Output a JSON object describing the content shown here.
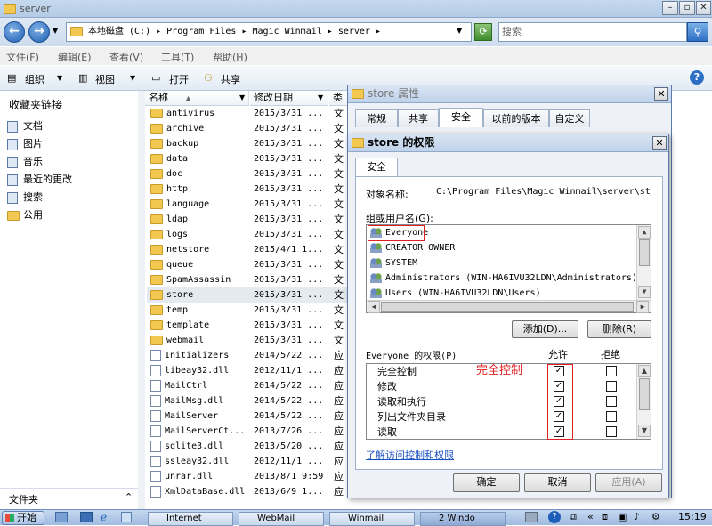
{
  "window": {
    "title": "server"
  },
  "address": {
    "path": "本地磁盘 (C:) ▸ Program Files ▸ Magic Winmail ▸ server ▸",
    "search_placeholder": "搜索"
  },
  "menu": [
    "文件(F)",
    "编辑(E)",
    "查看(V)",
    "工具(T)",
    "帮助(H)"
  ],
  "toolbar": {
    "organize": "组织",
    "views": "视图",
    "open": "打开",
    "share": "共享"
  },
  "sidebar": {
    "heading": "收藏夹链接",
    "items": [
      "文档",
      "图片",
      "音乐",
      "最近的更改",
      "搜索",
      "公用"
    ],
    "bottom": "文件夹"
  },
  "columns": {
    "name": "名称",
    "date": "修改日期",
    "type": "类"
  },
  "files": [
    {
      "name": "antivirus",
      "date": "2015/3/31 ...",
      "type": "文",
      "kind": "folder"
    },
    {
      "name": "archive",
      "date": "2015/3/31 ...",
      "type": "文",
      "kind": "folder"
    },
    {
      "name": "backup",
      "date": "2015/3/31 ...",
      "type": "文",
      "kind": "folder"
    },
    {
      "name": "data",
      "date": "2015/3/31 ...",
      "type": "文",
      "kind": "folder"
    },
    {
      "name": "doc",
      "date": "2015/3/31 ...",
      "type": "文",
      "kind": "folder"
    },
    {
      "name": "http",
      "date": "2015/3/31 ...",
      "type": "文",
      "kind": "folder"
    },
    {
      "name": "language",
      "date": "2015/3/31 ...",
      "type": "文",
      "kind": "folder"
    },
    {
      "name": "ldap",
      "date": "2015/3/31 ...",
      "type": "文",
      "kind": "folder"
    },
    {
      "name": "logs",
      "date": "2015/3/31 ...",
      "type": "文",
      "kind": "folder"
    },
    {
      "name": "netstore",
      "date": "2015/4/1 1...",
      "type": "文",
      "kind": "folder"
    },
    {
      "name": "queue",
      "date": "2015/3/31 ...",
      "type": "文",
      "kind": "folder"
    },
    {
      "name": "SpamAssassin",
      "date": "2015/3/31 ...",
      "type": "文",
      "kind": "folder"
    },
    {
      "name": "store",
      "date": "2015/3/31 ...",
      "type": "文",
      "kind": "folder",
      "selected": true
    },
    {
      "name": "temp",
      "date": "2015/3/31 ...",
      "type": "文",
      "kind": "folder"
    },
    {
      "name": "template",
      "date": "2015/3/31 ...",
      "type": "文",
      "kind": "folder"
    },
    {
      "name": "webmail",
      "date": "2015/3/31 ...",
      "type": "文",
      "kind": "folder"
    },
    {
      "name": "Initializers",
      "date": "2014/5/22 ...",
      "type": "应",
      "kind": "file"
    },
    {
      "name": "libeay32.dll",
      "date": "2012/11/1 ...",
      "type": "应",
      "kind": "file"
    },
    {
      "name": "MailCtrl",
      "date": "2014/5/22 ...",
      "type": "应",
      "kind": "file"
    },
    {
      "name": "MailMsg.dll",
      "date": "2014/5/22 ...",
      "type": "应",
      "kind": "file"
    },
    {
      "name": "MailServer",
      "date": "2014/5/22 ...",
      "type": "应",
      "kind": "file"
    },
    {
      "name": "MailServerCt...",
      "date": "2013/7/26 ...",
      "type": "应",
      "kind": "file"
    },
    {
      "name": "sqlite3.dll",
      "date": "2013/5/20 ...",
      "type": "应",
      "kind": "file"
    },
    {
      "name": "ssleay32.dll",
      "date": "2012/11/1 ...",
      "type": "应",
      "kind": "file"
    },
    {
      "name": "unrar.dll",
      "date": "2013/8/1 9:59",
      "type": "应",
      "kind": "file"
    },
    {
      "name": "XmlDataBase.dll",
      "date": "2013/6/9 1...",
      "type": "应",
      "kind": "file"
    }
  ],
  "props_dialog": {
    "title": "store 属性",
    "tabs": [
      "常规",
      "共享",
      "安全",
      "以前的版本",
      "自定义"
    ],
    "active_tab": 2
  },
  "perm_dialog": {
    "title": "store 的权限",
    "tab": "安全",
    "object_label": "对象名称:",
    "object_value": "C:\\Program Files\\Magic Winmail\\server\\st",
    "group_label": "组或用户名(G):",
    "users": [
      "Everyone",
      "CREATOR OWNER",
      "SYSTEM",
      "Administrators (WIN-HA6IVU32LDN\\Administrators)",
      "Users (WIN-HA6IVU32LDN\\Users)"
    ],
    "add_button": "添加(D)...",
    "remove_button": "删除(R)",
    "perm_label": "Everyone 的权限(P)",
    "allow_header": "允许",
    "deny_header": "拒绝",
    "annotation": "完全控制",
    "permissions": [
      {
        "name": "完全控制",
        "allow": true,
        "deny": false
      },
      {
        "name": "修改",
        "allow": true,
        "deny": false
      },
      {
        "name": "读取和执行",
        "allow": true,
        "deny": false
      },
      {
        "name": "列出文件夹目录",
        "allow": true,
        "deny": false
      },
      {
        "name": "读取",
        "allow": true,
        "deny": false
      }
    ],
    "help_link": "了解访问控制和权限",
    "ok_button": "确定",
    "cancel_button": "取消",
    "apply_button": "应用(A)"
  },
  "taskbar": {
    "start": "开始",
    "tasks": [
      "Internet",
      "WebMail",
      "Winmail",
      "2 Windo"
    ],
    "clock": "15:19"
  }
}
